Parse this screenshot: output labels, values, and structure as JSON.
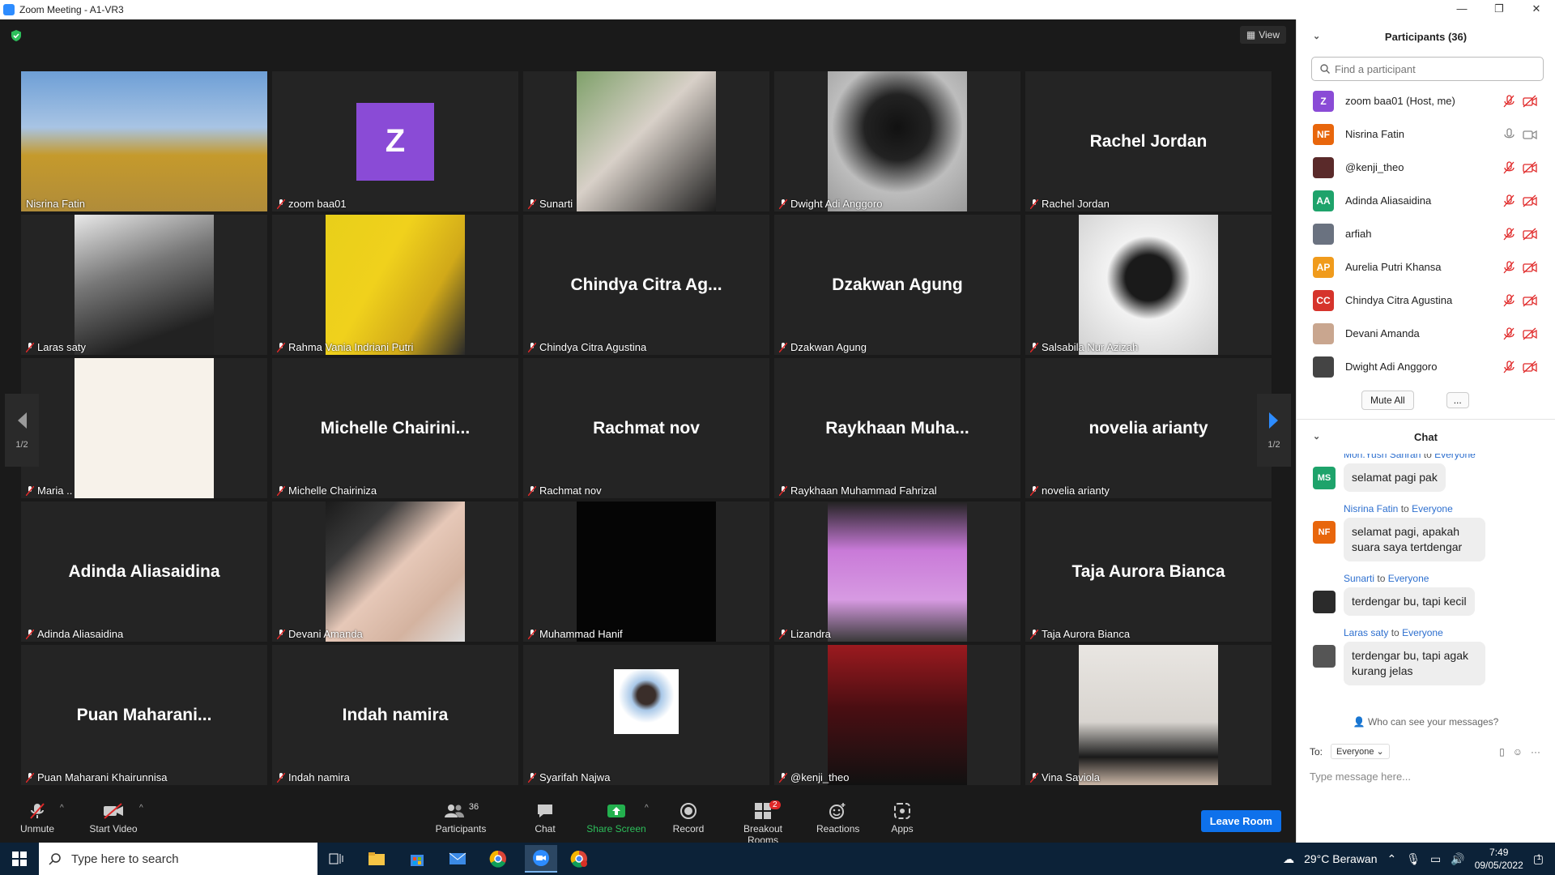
{
  "window": {
    "title": "Zoom Meeting - A1-VR3",
    "minimize": "—",
    "restore": "❐",
    "close": "✕"
  },
  "stage": {
    "view_label": "View",
    "page_indicator": "1/2"
  },
  "tiles": [
    {
      "label": "Nisrina Fatin",
      "big": "",
      "kind": "photo",
      "active": true
    },
    {
      "label": "zoom baa01",
      "big": "",
      "kind": "avatar",
      "avatar": "Z"
    },
    {
      "label": "Sunarti",
      "big": "",
      "kind": "photo"
    },
    {
      "label": "Dwight Adi Anggoro",
      "big": "",
      "kind": "photo"
    },
    {
      "label": "Rachel Jordan",
      "big": "Rachel Jordan",
      "kind": "name"
    },
    {
      "label": "Laras saty",
      "big": "",
      "kind": "photo"
    },
    {
      "label": "Rahma Vania Indriani Putri",
      "big": "",
      "kind": "photo"
    },
    {
      "label": "Chindya Citra Agustina",
      "big": "Chindya Citra Ag...",
      "kind": "name"
    },
    {
      "label": "Dzakwan Agung",
      "big": "Dzakwan Agung",
      "kind": "name"
    },
    {
      "label": "Salsabila Nur Azizah",
      "big": "",
      "kind": "photo"
    },
    {
      "label": "Maria ..",
      "big": "",
      "kind": "photo"
    },
    {
      "label": "Michelle Chairiniza",
      "big": "Michelle  Chairini...",
      "kind": "name"
    },
    {
      "label": "Rachmat nov",
      "big": "Rachmat nov",
      "kind": "name"
    },
    {
      "label": "Raykhaan Muhammad Fahrizal",
      "big": "Raykhaan  Muha...",
      "kind": "name"
    },
    {
      "label": "novelia arianty",
      "big": "novelia arianty",
      "kind": "name"
    },
    {
      "label": "Adinda Aliasaidina",
      "big": "Adinda Aliasaidina",
      "kind": "name"
    },
    {
      "label": "Devani Amanda",
      "big": "",
      "kind": "photo"
    },
    {
      "label": "Muhammad Hanif",
      "big": "",
      "kind": "photo"
    },
    {
      "label": "Lizandra",
      "big": "",
      "kind": "photo"
    },
    {
      "label": "Taja Aurora Bianca",
      "big": "Taja Aurora Bianca",
      "kind": "name"
    },
    {
      "label": "Puan Maharani Khairunnisa",
      "big": "Puan  Maharani...",
      "kind": "name"
    },
    {
      "label": "Indah namira",
      "big": "Indah namira",
      "kind": "name"
    },
    {
      "label": "Syarifah Najwa",
      "big": "",
      "kind": "photo"
    },
    {
      "label": "@kenji_theo",
      "big": "",
      "kind": "photo"
    },
    {
      "label": "Vina Saviola",
      "big": "",
      "kind": "photo"
    }
  ],
  "toolbar": {
    "unmute": "Unmute",
    "start_video": "Start Video",
    "participants": "Participants",
    "participants_count": "36",
    "chat": "Chat",
    "share": "Share Screen",
    "record": "Record",
    "breakout": "Breakout Rooms",
    "breakout_badge": "2",
    "reactions": "Reactions",
    "apps": "Apps",
    "leave": "Leave Room"
  },
  "participants": {
    "title": "Participants (36)",
    "search_placeholder": "Find a participant",
    "items": [
      {
        "name": "zoom baa01 (Host, me)",
        "initials": "Z",
        "color": "#8a4bd6",
        "mic": "muted",
        "video": "off"
      },
      {
        "name": "Nisrina Fatin",
        "initials": "NF",
        "color": "#e8660c",
        "mic": "on",
        "video": "on"
      },
      {
        "name": "@kenji_theo",
        "initials": "",
        "color": "#5a2a2a",
        "mic": "muted",
        "video": "off"
      },
      {
        "name": "Adinda Aliasaidina",
        "initials": "AA",
        "color": "#1ea36b",
        "mic": "muted",
        "video": "off"
      },
      {
        "name": "arfiah",
        "initials": "",
        "color": "#6a7280",
        "mic": "muted",
        "video": "off"
      },
      {
        "name": "Aurelia Putri Khansa",
        "initials": "AP",
        "color": "#f09b1c",
        "mic": "muted",
        "video": "off"
      },
      {
        "name": "Chindya Citra Agustina",
        "initials": "CC",
        "color": "#d6342c",
        "mic": "muted",
        "video": "off"
      },
      {
        "name": "Devani Amanda",
        "initials": "",
        "color": "#c9a68f",
        "mic": "muted",
        "video": "off"
      },
      {
        "name": "Dwight Adi Anggoro",
        "initials": "",
        "color": "#444444",
        "mic": "muted",
        "video": "off"
      }
    ],
    "mute_all": "Mute All",
    "more": "..."
  },
  "chat": {
    "title": "Chat",
    "to_word": "to",
    "messages": [
      {
        "from": "Moh.Yusri Sahrah",
        "to": "Everyone",
        "text": "selamat pagi pak",
        "initials": "MS",
        "color": "#1ea36b"
      },
      {
        "from": "Nisrina Fatin",
        "to": "Everyone",
        "text": "selamat pagi, apakah suara saya tertdengar",
        "initials": "NF",
        "color": "#e8660c"
      },
      {
        "from": "Sunarti",
        "to": "Everyone",
        "text": "terdengar bu, tapi kecil",
        "initials": "",
        "color": "#2b2b2b"
      },
      {
        "from": "Laras saty",
        "to": "Everyone",
        "text": "terdengar bu, tapi agak kurang jelas",
        "initials": "",
        "color": "#555555"
      }
    ],
    "who_can_see": "Who can see your messages?",
    "to_label": "To:",
    "to_value": "Everyone",
    "input_placeholder": "Type message here..."
  },
  "taskbar": {
    "search_placeholder": "Type here to search",
    "weather": "29°C  Berawan",
    "time": "7:49",
    "date": "09/05/2022",
    "notif_count": "1"
  }
}
